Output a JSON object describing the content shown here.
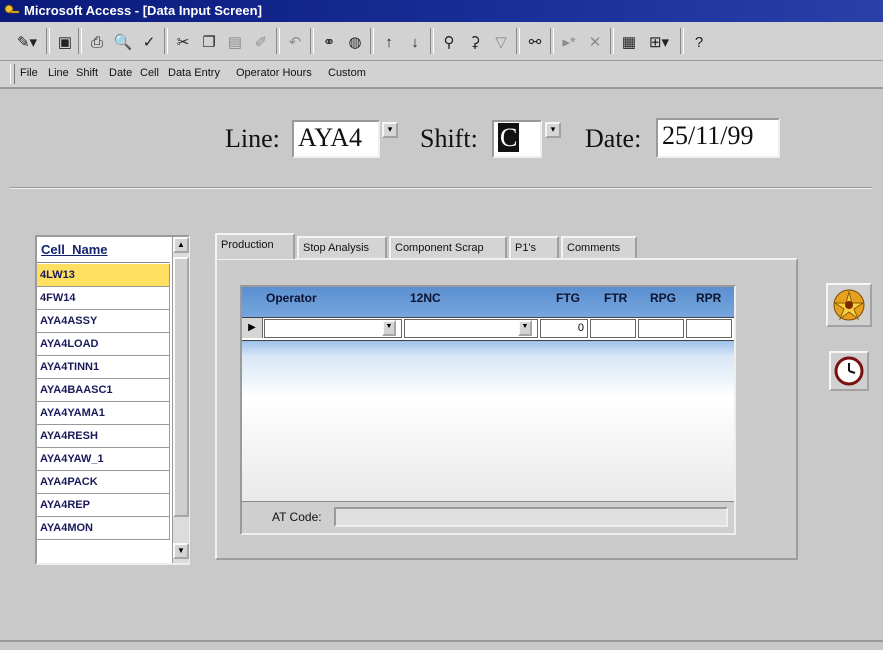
{
  "window": {
    "title": "Microsoft Access - [Data Input Screen]"
  },
  "toolbar": {
    "icons": [
      "view-icon",
      "save-icon",
      "print-icon",
      "print-preview-icon",
      "spelling-icon",
      "cut-icon",
      "copy-icon",
      "paste-icon",
      "format-painter-icon",
      "undo-icon",
      "insert-hyperlink-icon",
      "web-toolbar-icon",
      "sort-ascending-icon",
      "sort-descending-icon",
      "filter-by-selection-icon",
      "filter-by-form-icon",
      "apply-filter-icon",
      "find-icon",
      "new-record-icon",
      "delete-record-icon",
      "database-window-icon",
      "new-object-icon",
      "help-icon"
    ]
  },
  "menu": {
    "items": [
      "File",
      "Line",
      "Shift",
      "Date",
      "Cell",
      "Data Entry",
      "Operator Hours",
      "Custom"
    ]
  },
  "header": {
    "line_label": "Line:",
    "line_value": "AYA4",
    "shift_label": "Shift:",
    "shift_value": "C",
    "date_label": "Date:",
    "date_value": "25/11/99"
  },
  "cell_list": {
    "header": "Cell_Name",
    "items": [
      "4LW13",
      "4FW14",
      "AYA4ASSY",
      "AYA4LOAD",
      "AYA4TINN1",
      "AYA4BAASC1",
      "AYA4YAMA1",
      "AYA4RESH",
      "AYA4YAW_1",
      "AYA4PACK",
      "AYA4REP",
      "AYA4MON"
    ],
    "selected_index": 0
  },
  "tabs": [
    "Production",
    "Stop Analysis",
    "Component Scrap",
    "P1's",
    "Comments"
  ],
  "active_tab": 0,
  "grid": {
    "columns": [
      "Operator",
      "12NC",
      "FTG",
      "FTR",
      "RPG",
      "RPR"
    ],
    "row": {
      "operator": "",
      "nc12": "",
      "ftg": "0",
      "ftr": "",
      "rpg": "",
      "rpr": ""
    }
  },
  "at_code": {
    "label": "AT Code:",
    "value": ""
  },
  "side_buttons": [
    "run-macro-icon",
    "clock-icon"
  ],
  "colors": {
    "title_bar": "#0a1a7a",
    "selected_cell": "#ffe060",
    "header_text": "#13236f"
  }
}
